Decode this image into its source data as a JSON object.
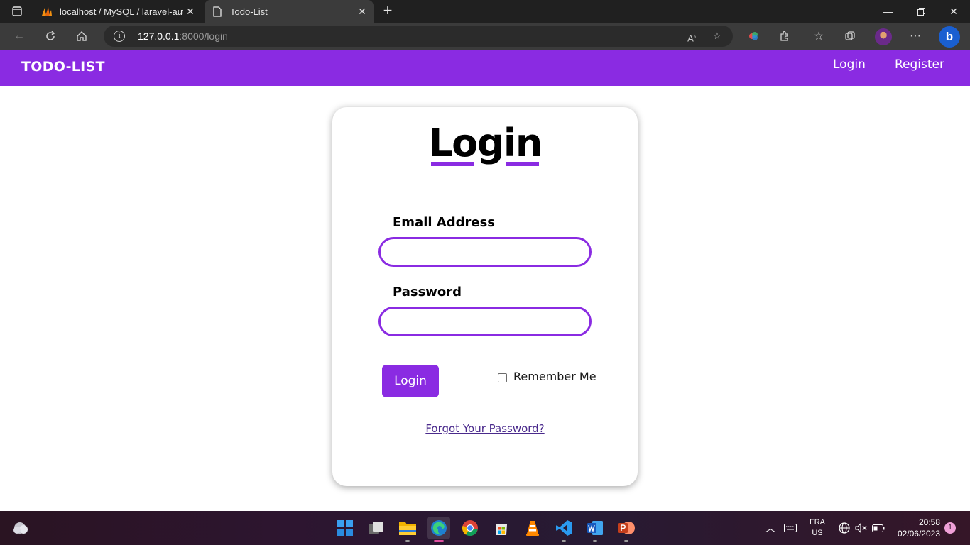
{
  "browser": {
    "tabs": [
      {
        "title": "localhost / MySQL / laravel-auth",
        "icon": "phpmyadmin-icon",
        "active": false
      },
      {
        "title": "Todo-List",
        "icon": "page-icon",
        "active": true
      }
    ],
    "url_host": "127.0.0.1",
    "url_rest": ":8000/login"
  },
  "navbar": {
    "brand": "TODO-LIST",
    "links": [
      "Login",
      "Register"
    ]
  },
  "form": {
    "title": "Login",
    "email_label": "Email Address",
    "email_value": "",
    "password_label": "Password",
    "password_value": "",
    "submit_label": "Login",
    "remember_label": "Remember Me",
    "remember_checked": false,
    "forgot_label": "Forgot Your Password?"
  },
  "taskbar": {
    "apps": [
      "start",
      "task-view",
      "file-explorer",
      "edge",
      "chrome",
      "store",
      "vlc",
      "vscode",
      "word",
      "powerpoint"
    ],
    "language": "FRA",
    "keyboard": "US",
    "time": "20:58",
    "date": "02/06/2023",
    "notifications": "1"
  },
  "colors": {
    "accent": "#8a2be2",
    "navbar_bg": "#8a2be2",
    "link": "#4a2a8c"
  }
}
